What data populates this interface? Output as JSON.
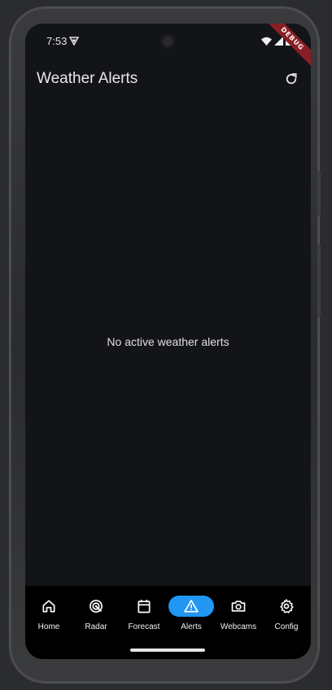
{
  "status_bar": {
    "time": "7:53",
    "icons": [
      "vpn-key-icon",
      "wifi-icon",
      "cell-signal-icon",
      "battery-icon"
    ]
  },
  "debug_banner": "DEBUG",
  "app_bar": {
    "title": "Weather Alerts",
    "action_icon": "refresh-icon"
  },
  "body": {
    "empty_message": "No active weather alerts"
  },
  "bottom_nav": {
    "selected_index": 3,
    "items": [
      {
        "label": "Home",
        "icon": "home-icon"
      },
      {
        "label": "Radar",
        "icon": "radar-icon"
      },
      {
        "label": "Forecast",
        "icon": "calendar-icon"
      },
      {
        "label": "Alerts",
        "icon": "warning-icon"
      },
      {
        "label": "Webcams",
        "icon": "camera-icon"
      },
      {
        "label": "Config",
        "icon": "gear-icon"
      }
    ]
  },
  "colors": {
    "background": "#121418",
    "nav_background": "#000000",
    "accent": "#2196f3",
    "debug_ribbon": "#8a1e25",
    "text": "#e8e8ea"
  }
}
